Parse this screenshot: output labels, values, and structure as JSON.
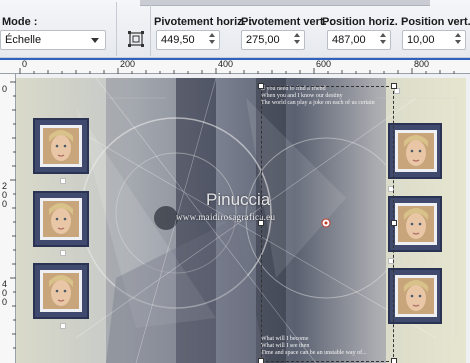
{
  "toolbar": {
    "mode_label": "Mode :",
    "mode_value": "Échelle",
    "pivot_h_label": "Pivotement horiz. :",
    "pivot_h_value": "449,50",
    "pivot_v_label": "Pivotement vert. :",
    "pivot_v_value": "275,00",
    "pos_h_label": "Position horiz. :",
    "pos_h_value": "487,00",
    "pos_v_label": "Position vert. :",
    "pos_v_value": "10,00"
  },
  "ruler": {
    "h_ticks": [
      "0",
      "200",
      "400",
      "600",
      "800"
    ],
    "v_ticks": [
      "0",
      "200",
      "400"
    ]
  },
  "canvas": {
    "watermark_title": "Pinuccia",
    "watermark_url": "www.maidirosagrafica.eu",
    "lyrics_top": [
      "If you need to find a friend",
      "When you and I know our destiny",
      "The world can play a joke on each of us certain"
    ],
    "lyrics_bottom": [
      "What will I become",
      "What will I see then",
      "Time and space can be an unstable way of..."
    ]
  },
  "colors": {
    "frame": "#3f4a6e",
    "ruler_accent": "#2f5fbf",
    "canvas_bg": "#d8d9cf"
  }
}
